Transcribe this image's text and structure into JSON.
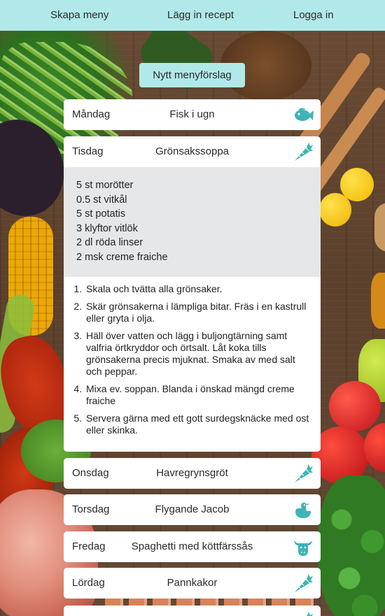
{
  "nav": {
    "create_menu": "Skapa meny",
    "add_recipe": "Lägg in recept",
    "login": "Logga in"
  },
  "new_menu_button": "Nytt menyförslag",
  "accent_color": "#b1e9ea",
  "icon_color": "#3fb3b5",
  "days": [
    {
      "day": "Måndag",
      "dish": "Fisk i ugn",
      "icon": "fish-icon"
    },
    {
      "day": "Tisdag",
      "dish": "Grönsakssoppa",
      "icon": "carrot-icon",
      "ingredients": [
        "5 st morötter",
        "0.5 st vitkål",
        "5 st potatis",
        "3 klyftor vitlök",
        "2 dl röda linser",
        "2 msk creme fraiche"
      ],
      "steps": [
        "Skala och tvätta alla grönsaker.",
        "Skär grönsakerna i lämpliga bitar. Fräs i en kastrull eller gryta i olja.",
        "Häll över vatten och lägg i buljongtärning samt valfria örtkryddor och örtsalt. Låt koka tills grönsakerna precis mjuknat. Smaka av med salt och peppar.",
        "Mixa ev. soppan. Blanda i önskad mängd creme fraiche",
        "Servera gärna med ett gott surdegsknäcke med ost eller skinka."
      ]
    },
    {
      "day": "Onsdag",
      "dish": "Havregrynsgröt",
      "icon": "carrot-icon"
    },
    {
      "day": "Torsdag",
      "dish": "Flygande Jacob",
      "icon": "chicken-icon"
    },
    {
      "day": "Fredag",
      "dish": "Spaghetti med köttfärssås",
      "icon": "cow-icon"
    },
    {
      "day": "Lördag",
      "dish": "Pannkakor",
      "icon": "carrot-icon"
    }
  ]
}
